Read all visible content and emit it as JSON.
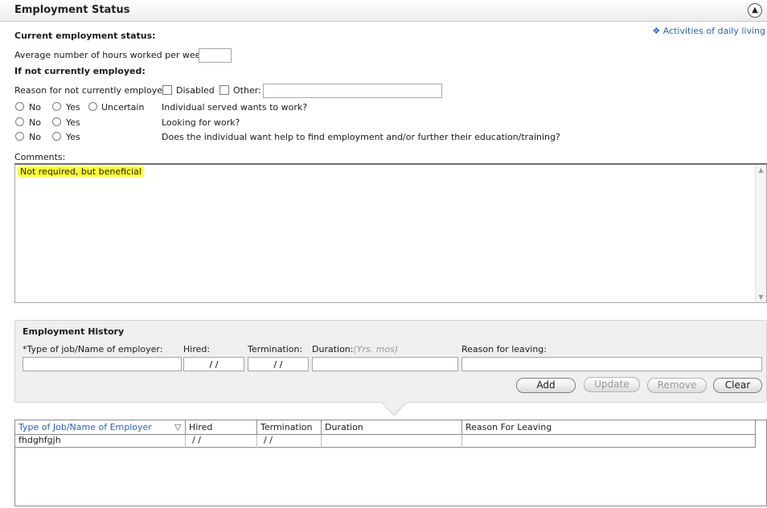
{
  "header": {
    "title": "Employment Status",
    "collapse_icon": "chevron-up-circle-icon"
  },
  "adl_link": "Activities of daily living",
  "current_status": {
    "label": "Current employment status:",
    "hours_label": "Average number of hours worked per week:",
    "hours_value": ""
  },
  "not_employed": {
    "label": "If not currently employed:",
    "reason_label": "Reason for not currently employed:",
    "disabled_label": "Disabled",
    "other_label": "Other:",
    "other_value": ""
  },
  "questions": [
    {
      "options": [
        "No",
        "Yes",
        "Uncertain"
      ],
      "text": "Individual served wants to work?"
    },
    {
      "options": [
        "No",
        "Yes"
      ],
      "text": "Looking for work?"
    },
    {
      "options": [
        "No",
        "Yes"
      ],
      "text": "Does the individual want help to find employment and/or further their education/training?"
    }
  ],
  "comments": {
    "label": "Comments:",
    "value": "Not required, but beneficial"
  },
  "history": {
    "title": "Employment History",
    "fields": {
      "job_label": "*Type of job/Name of employer:",
      "hired_label": "Hired:",
      "termination_label": "Termination:",
      "duration_label": "Duration:",
      "duration_hint": "(Yrs, mos)",
      "reason_label": "Reason for leaving:",
      "hired_value": "/ /",
      "termination_value": "/ /"
    },
    "buttons": {
      "add": "Add",
      "update": "Update",
      "remove": "Remove",
      "clear": "Clear"
    }
  },
  "grid": {
    "columns": [
      "Type of Job/Name of Employer",
      "Hired",
      "Termination",
      "Duration",
      "Reason For Leaving"
    ],
    "rows": [
      {
        "job": "fhdghfgjh",
        "hired": "/ /",
        "termination": "/ /",
        "duration": "",
        "reason": ""
      }
    ]
  },
  "colors": {
    "link": "#2a62b8",
    "highlight": "#ffff33"
  }
}
